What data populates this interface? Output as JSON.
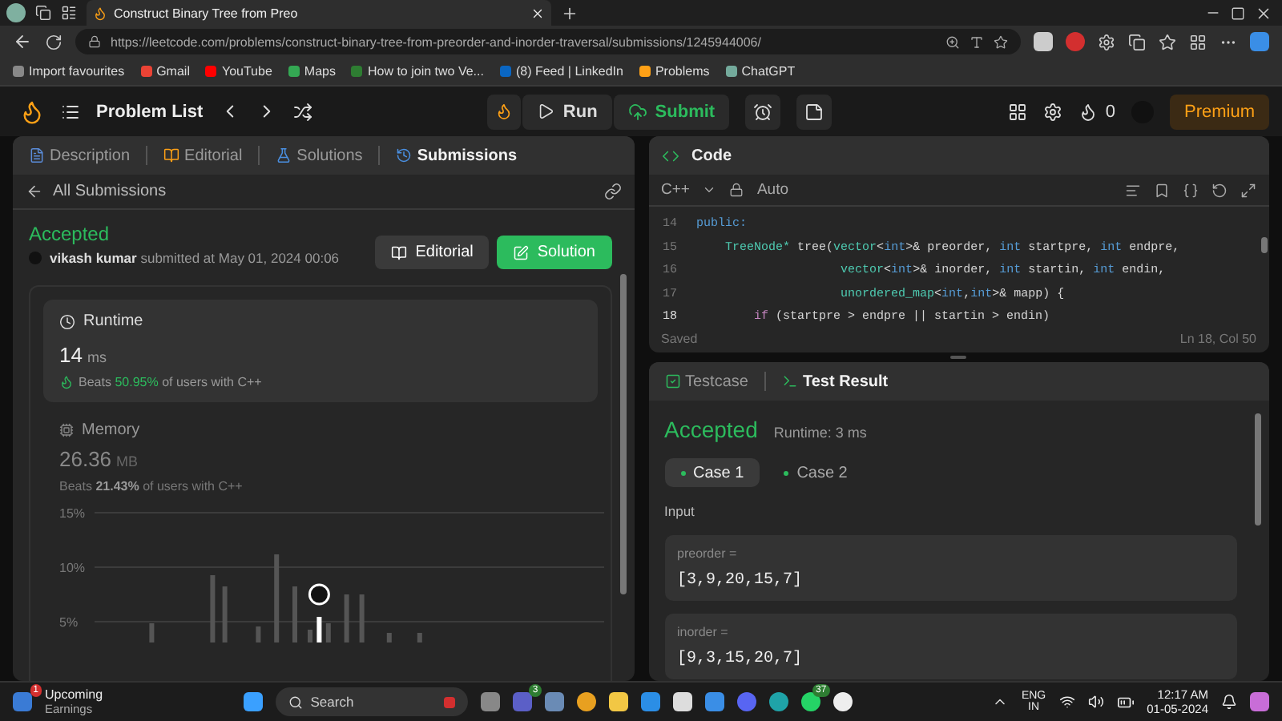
{
  "browser": {
    "tab_title": "Construct Binary Tree from Preo",
    "url": "https://leetcode.com/problems/construct-binary-tree-from-preorder-and-inorder-traversal/submissions/1245944006/",
    "bookmarks": [
      "Import favourites",
      "Gmail",
      "YouTube",
      "Maps",
      "How to join two Ve...",
      "(8) Feed | LinkedIn",
      "Problems",
      "ChatGPT"
    ]
  },
  "nav": {
    "problem_list": "Problem List",
    "run": "Run",
    "submit": "Submit",
    "streak": "0",
    "premium": "Premium"
  },
  "left_tabs": [
    {
      "label": "Description",
      "selected": false
    },
    {
      "label": "Editorial",
      "selected": false
    },
    {
      "label": "Solutions",
      "selected": false
    },
    {
      "label": "Submissions",
      "selected": true
    }
  ],
  "submission": {
    "back": "All Submissions",
    "status": "Accepted",
    "user": "vikash kumar",
    "submitted": "submitted at May 01, 2024 00:06",
    "editorial": "Editorial",
    "solution": "Solution",
    "runtime": {
      "title": "Runtime",
      "value": "14",
      "unit": "ms",
      "beats": "Beats",
      "percent": "50.95%",
      "suffix": "of users with C++"
    },
    "memory": {
      "title": "Memory",
      "value": "26.36",
      "unit": "MB",
      "beats": "Beats",
      "percent": "21.43%",
      "suffix": "of users with C++",
      "ticks": [
        "15%",
        "10%",
        "5%"
      ]
    }
  },
  "code": {
    "title": "Code",
    "language": "C++",
    "mode": "Auto",
    "status": "Saved",
    "position": "Ln 18, Col 50",
    "lines": [
      {
        "number": "14",
        "current": false,
        "tokens": [
          {
            "text": "public:",
            "kind": "keyword"
          }
        ]
      },
      {
        "number": "15",
        "current": false,
        "tokens": [
          {
            "text": "    TreeNode*",
            "kind": "type"
          },
          {
            "text": " tree(",
            "kind": "plain"
          },
          {
            "text": "vector",
            "kind": "type"
          },
          {
            "text": "<",
            "kind": "plain"
          },
          {
            "text": "int",
            "kind": "keyword"
          },
          {
            "text": ">& preorder, ",
            "kind": "plain"
          },
          {
            "text": "int",
            "kind": "keyword"
          },
          {
            "text": " startpre, ",
            "kind": "plain"
          },
          {
            "text": "int",
            "kind": "keyword"
          },
          {
            "text": " endpre,",
            "kind": "plain"
          }
        ]
      },
      {
        "number": "16",
        "current": false,
        "tokens": [
          {
            "text": "                    vector",
            "kind": "type"
          },
          {
            "text": "<",
            "kind": "plain"
          },
          {
            "text": "int",
            "kind": "keyword"
          },
          {
            "text": ">& inorder, ",
            "kind": "plain"
          },
          {
            "text": "int",
            "kind": "keyword"
          },
          {
            "text": " startin, ",
            "kind": "plain"
          },
          {
            "text": "int",
            "kind": "keyword"
          },
          {
            "text": " endin,",
            "kind": "plain"
          }
        ]
      },
      {
        "number": "17",
        "current": false,
        "tokens": [
          {
            "text": "                    unordered_map",
            "kind": "type"
          },
          {
            "text": "<",
            "kind": "plain"
          },
          {
            "text": "int",
            "kind": "keyword"
          },
          {
            "text": ",",
            "kind": "plain"
          },
          {
            "text": "int",
            "kind": "keyword"
          },
          {
            "text": ">& mapp) {",
            "kind": "plain"
          }
        ]
      },
      {
        "number": "18",
        "current": true,
        "tokens": [
          {
            "text": "        if",
            "kind": "control"
          },
          {
            "text": " (startpre > endpre || startin > endin)",
            "kind": "plain"
          }
        ]
      }
    ]
  },
  "results": {
    "tabs": [
      {
        "label": "Testcase",
        "selected": false
      },
      {
        "label": "Test Result",
        "selected": true
      }
    ],
    "status": "Accepted",
    "runtime": "Runtime: 3 ms",
    "cases": [
      {
        "label": "Case 1",
        "selected": true
      },
      {
        "label": "Case 2",
        "selected": false
      }
    ],
    "input_label": "Input",
    "inputs": [
      {
        "name": "preorder =",
        "value": "[3,9,20,15,7]"
      },
      {
        "name": "inorder =",
        "value": "[9,3,15,20,7]"
      }
    ]
  },
  "taskbar": {
    "widget_title": "Upcoming",
    "widget_subtitle": "Earnings",
    "widget_badge": "1",
    "search": "Search",
    "teams_badge": "3",
    "whatsapp_badge": "37",
    "language": "ENG",
    "region": "IN",
    "time": "12:17 AM",
    "date": "01-05-2024"
  }
}
